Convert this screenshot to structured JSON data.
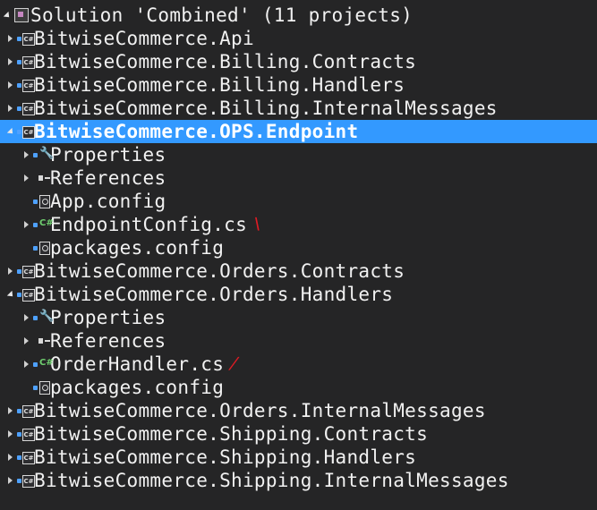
{
  "solution": {
    "label": "Solution 'Combined' (11 projects)",
    "icon": "solution-icon"
  },
  "rows": [
    {
      "label": "BitwiseCommerce.Api",
      "type": "project",
      "expanded": false
    },
    {
      "label": "BitwiseCommerce.Billing.Contracts",
      "type": "project",
      "expanded": false
    },
    {
      "label": "BitwiseCommerce.Billing.Handlers",
      "type": "project",
      "expanded": false
    },
    {
      "label": "BitwiseCommerce.Billing.InternalMessages",
      "type": "project",
      "expanded": false
    },
    {
      "label": "BitwiseCommerce.OPS.Endpoint",
      "type": "project",
      "expanded": true,
      "selected": true
    },
    {
      "label": "Properties",
      "type": "properties",
      "expanded": false
    },
    {
      "label": "References",
      "type": "references",
      "expanded": false
    },
    {
      "label": "App.config",
      "type": "config"
    },
    {
      "label": "EndpointConfig.cs",
      "type": "csfile",
      "expanded": false,
      "mark": "\\"
    },
    {
      "label": "packages.config",
      "type": "config"
    },
    {
      "label": "BitwiseCommerce.Orders.Contracts",
      "type": "project",
      "expanded": false
    },
    {
      "label": "BitwiseCommerce.Orders.Handlers",
      "type": "project",
      "expanded": true
    },
    {
      "label": "Properties",
      "type": "properties",
      "expanded": false
    },
    {
      "label": "References",
      "type": "references",
      "expanded": false
    },
    {
      "label": "OrderHandler.cs",
      "type": "csfile",
      "expanded": false,
      "mark": "/"
    },
    {
      "label": "packages.config",
      "type": "config"
    },
    {
      "label": "BitwiseCommerce.Orders.InternalMessages",
      "type": "project",
      "expanded": false
    },
    {
      "label": "BitwiseCommerce.Shipping.Contracts",
      "type": "project",
      "expanded": false
    },
    {
      "label": "BitwiseCommerce.Shipping.Handlers",
      "type": "project",
      "expanded": false
    },
    {
      "label": "BitwiseCommerce.Shipping.InternalMessages",
      "type": "project",
      "expanded": false
    }
  ],
  "icons": {
    "project": "csharp-project-icon",
    "csfile": "csharp-file-icon",
    "properties": "wrench-icon",
    "references": "references-icon",
    "config": "config-file-icon"
  },
  "colors": {
    "background": "#252526",
    "selection": "#3399ff",
    "text": "#f1f1f1"
  }
}
